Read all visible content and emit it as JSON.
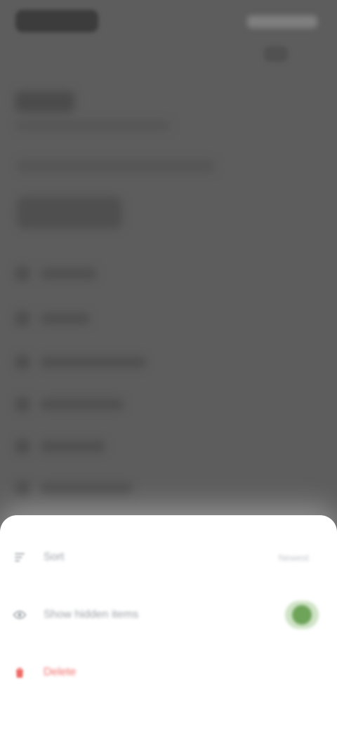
{
  "sheet": {
    "items": [
      {
        "label": "Sort",
        "value": "Newest"
      },
      {
        "label": "Show hidden items"
      },
      {
        "label": "Delete"
      }
    ],
    "toggle_on": true,
    "accent_color": "#6ea45a",
    "danger_color": "#ef6a66"
  },
  "icons": {
    "sort": "sort-icon",
    "hidden": "eye-icon",
    "delete": "trash-icon"
  }
}
